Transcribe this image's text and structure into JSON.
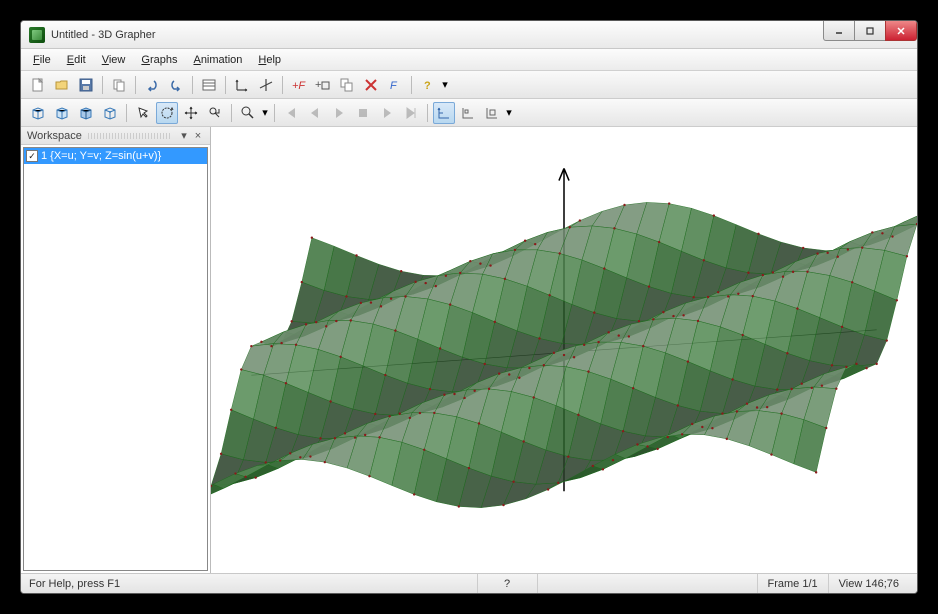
{
  "window": {
    "title": "Untitled - 3D Grapher"
  },
  "menus": {
    "file": "File",
    "edit": "Edit",
    "view": "View",
    "graphs": "Graphs",
    "animation": "Animation",
    "help": "Help"
  },
  "workspace": {
    "title": "Workspace",
    "items": [
      {
        "checked": true,
        "label": "1 {X=u; Y=v; Z=sin(u+v)}"
      }
    ]
  },
  "toolbar_icons": {
    "new": "new-icon",
    "open": "open-icon",
    "save": "save-icon",
    "copy": "copy-icon",
    "undo": "undo-icon",
    "redo": "redo-icon",
    "props": "props-icon",
    "axes": "axes-icon",
    "axes2": "axes2-icon",
    "addfn": "addfn-icon",
    "addbox": "addbox-icon",
    "dupfn": "dupfn-icon",
    "delfn": "delfn-icon",
    "editfn": "editfn-icon",
    "help": "help-icon",
    "cube1": "cube1-icon",
    "cube2": "cube2-icon",
    "cube3": "cube3-icon",
    "cube4": "cube4-icon",
    "arrow": "arrow-icon",
    "rotate": "rotate-icon",
    "pan": "pan-icon",
    "zoomaxis": "zoomaxis-icon",
    "zoom": "zoom-icon",
    "first": "first-icon",
    "prev": "prev-icon",
    "play": "play-icon",
    "stop": "stop-icon",
    "next": "next-icon",
    "last": "last-icon",
    "snap1": "snap1-icon",
    "snap2": "snap2-icon",
    "snap3": "snap3-icon"
  },
  "status": {
    "help": "For Help, press F1",
    "q": "?",
    "frame": "Frame 1/1",
    "view": "View 146;76"
  },
  "graph": {
    "formula": "Z = sin(u+v)",
    "u_range": [
      -5,
      5
    ],
    "v_range": [
      -5,
      5
    ],
    "type": "parametric-surface"
  }
}
